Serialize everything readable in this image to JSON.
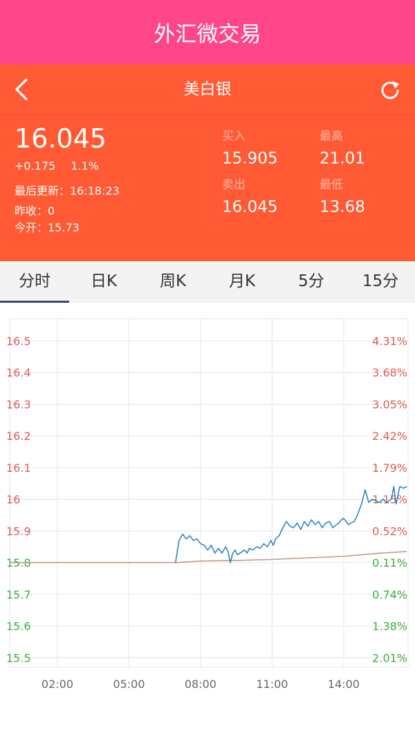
{
  "app": {
    "title": "外汇微交易",
    "bg": "#ff4689"
  },
  "nav": {
    "title": "美白银",
    "bg": "#ff5a33"
  },
  "quote": {
    "price": "16.045",
    "change": "+0.175",
    "change_pct": "1.1%",
    "updated": "最后更新：16:18:23",
    "prev_close": "昨收：0",
    "open_today": "今开：15.73",
    "buy_label": "买入",
    "buy_value": "15.905",
    "high_label": "最高",
    "high_value": "21.01",
    "sell_label": "卖出",
    "sell_value": "16.045",
    "low_label": "最低",
    "low_value": "13.68"
  },
  "tabs": [
    {
      "label": "分时",
      "active": true
    },
    {
      "label": "日K",
      "active": false
    },
    {
      "label": "周K",
      "active": false
    },
    {
      "label": "月K",
      "active": false
    },
    {
      "label": "5分",
      "active": false
    },
    {
      "label": "15分",
      "active": false
    }
  ],
  "chart_data": {
    "type": "line",
    "x_ticks": [
      "02:00",
      "05:00",
      "08:00",
      "11:00",
      "14:00"
    ],
    "y_ticks": [
      "16.5",
      "16.4",
      "16.3",
      "16.2",
      "16.1",
      "16",
      "15.9",
      "15.8",
      "15.7",
      "15.6",
      "15.5"
    ],
    "y_values": [
      16.5,
      16.4,
      16.3,
      16.2,
      16.1,
      16.0,
      15.9,
      15.8,
      15.7,
      15.6,
      15.5
    ],
    "pct_ticks": [
      "4.31%",
      "3.68%",
      "3.05%",
      "2.42%",
      "1.79%",
      "1.15%",
      "0.52%",
      "0.11%",
      "0.74%",
      "1.38%",
      "2.01%"
    ],
    "xlim_hours": [
      0,
      16.7
    ],
    "ylim": [
      15.47,
      16.57
    ],
    "colors": {
      "up": "#e05a57",
      "down": "#3bb041",
      "price_line": "#2e86c1",
      "avg_line": "#c49a8a",
      "grid": "#e6e6e6"
    },
    "series": [
      {
        "x": [
          6.95,
          7.1,
          7.25,
          7.4,
          7.55,
          7.7,
          7.85,
          8.0,
          8.15,
          8.3,
          8.45,
          8.6,
          8.75,
          8.9,
          9.05,
          9.15,
          9.25,
          9.35,
          9.45,
          9.55,
          9.65,
          9.75,
          9.85,
          9.95,
          10.05,
          10.2,
          10.35,
          10.5,
          10.65,
          10.8,
          10.95,
          11.05,
          11.15,
          11.3,
          11.45,
          11.6,
          11.75,
          11.9,
          12.05,
          12.2,
          12.35,
          12.5,
          12.65,
          12.8,
          12.95,
          13.1,
          13.25,
          13.4,
          13.55,
          13.7,
          13.8,
          13.9,
          14.0,
          14.1,
          14.2,
          14.3,
          14.45,
          14.6,
          14.75,
          14.9,
          15.05,
          15.2,
          15.35,
          15.5,
          15.65,
          15.8,
          15.9,
          16.0,
          16.1,
          16.2,
          16.35,
          16.5,
          16.65
        ],
        "y": [
          15.8,
          15.87,
          15.89,
          15.875,
          15.885,
          15.87,
          15.875,
          15.86,
          15.855,
          15.84,
          15.855,
          15.83,
          15.845,
          15.83,
          15.85,
          15.835,
          15.8,
          15.83,
          15.84,
          15.825,
          15.83,
          15.835,
          15.84,
          15.83,
          15.845,
          15.84,
          15.85,
          15.845,
          15.86,
          15.85,
          15.87,
          15.855,
          15.875,
          15.885,
          15.91,
          15.93,
          15.915,
          15.91,
          15.925,
          15.905,
          15.93,
          15.915,
          15.935,
          15.92,
          15.93,
          15.91,
          15.925,
          15.93,
          15.91,
          15.92,
          15.925,
          15.935,
          15.94,
          15.93,
          15.92,
          15.925,
          15.93,
          15.955,
          15.985,
          16.03,
          15.99,
          16.0,
          15.995,
          15.99,
          16.0,
          15.99,
          15.995,
          16.0,
          16.04,
          15.985,
          16.04,
          16.035,
          16.04
        ]
      },
      {
        "x": [
          0.0,
          6.95,
          8.0,
          9.5,
          11.0,
          12.5,
          14.0,
          15.5,
          16.65
        ],
        "y": [
          15.8,
          15.8,
          15.805,
          15.807,
          15.81,
          15.815,
          15.82,
          15.83,
          15.835
        ]
      }
    ]
  }
}
